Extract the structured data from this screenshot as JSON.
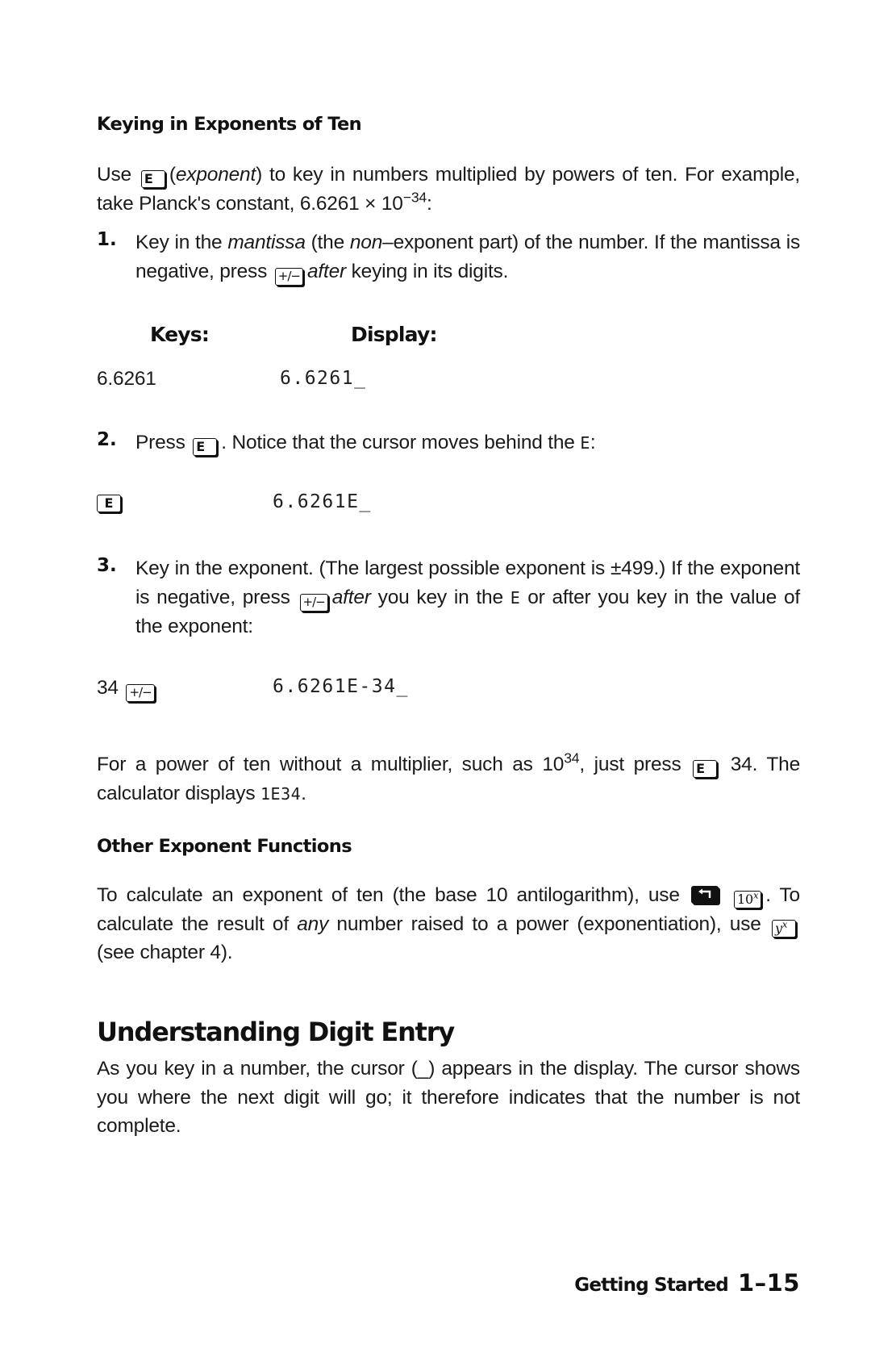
{
  "sections": {
    "exponents": {
      "heading": "Keying in Exponents of Ten",
      "intro": {
        "pre": "Use",
        "key": "E",
        "em": "exponent",
        "post": ") to key in numbers multiplied by powers of ten. For example, take Planck's constant, 6.6261 × 10",
        "sup": "−34",
        "tail": ":"
      },
      "steps": [
        {
          "num": "1.",
          "text_a": "Key in the ",
          "em_a": "mantissa",
          "text_b": " (the ",
          "em_b": "non",
          "text_c": "–exponent part) of the number. If the mantissa is negative, press",
          "key": "+/−",
          "em_c": "after",
          "text_d": " keying in its digits."
        },
        {
          "num": "2.",
          "text_a": "Press",
          "key": "E",
          "text_b": ". Notice that the cursor moves behind the ",
          "lcd": "E",
          "text_c": ":"
        },
        {
          "num": "3.",
          "text_a": "Key in the exponent. (The largest possible exponent is ±499.) If the exponent is negative, press",
          "key": "+/−",
          "em_a": "after",
          "text_b": " you key in the ",
          "lcd": "E",
          "text_c": " or after you key in the value of the exponent:"
        }
      ],
      "table_headers": {
        "keys": "Keys:",
        "display": "Display:"
      },
      "rows": [
        {
          "keys_text": "6.6261",
          "keys_key": "",
          "display": "6.6261_"
        },
        {
          "keys_text": "",
          "keys_key": "E",
          "display": "6.6261E_"
        },
        {
          "keys_text": "34",
          "keys_key": "+/−",
          "display": "6.6261E-34_"
        }
      ],
      "power_para": {
        "pre": "For a power of ten without a multiplier, such as 10",
        "sup": "34",
        "mid": ", just press",
        "key": "E",
        "post": " 34. The calculator displays ",
        "lcd": "1E34",
        "tail": "."
      }
    },
    "other_functions": {
      "heading": "Other Exponent Functions",
      "para": {
        "pre": "To calculate an exponent of ten (the base 10 antilogarithm), use",
        "key_shift": "left-shift",
        "key_10x_base": "10",
        "key_10x_sup": "x",
        "mid": ". To calculate the result of ",
        "em": "any",
        "mid2": " number raised to a power (exponentiation), use",
        "key_yx_base": "y",
        "key_yx_sup": "x",
        "post": "(see chapter 4)."
      }
    },
    "digit_entry": {
      "heading": "Understanding Digit Entry",
      "para": "As you key in a number, the cursor (_) appears in the display. The cursor shows you where the next digit will go; it therefore indicates that the number is not complete."
    }
  },
  "footer": {
    "section": "Getting Started",
    "page": "1–15"
  }
}
